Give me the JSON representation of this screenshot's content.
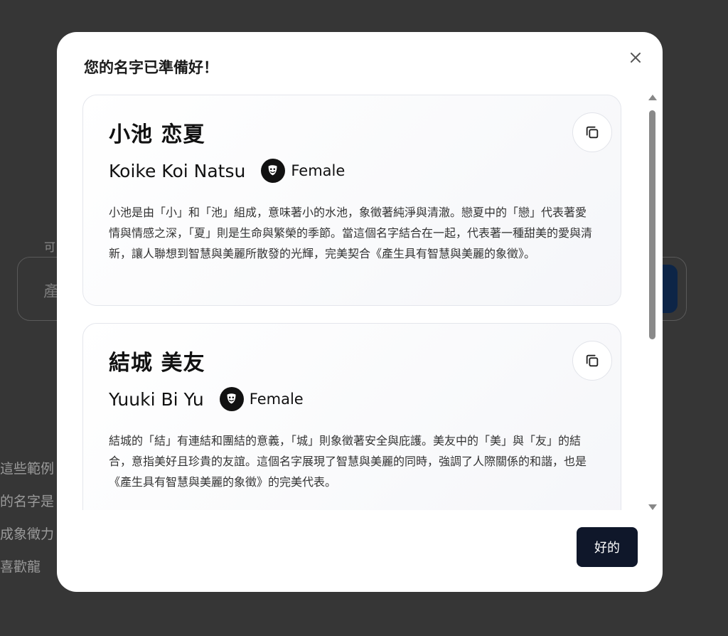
{
  "background": {
    "field_label": "可",
    "input_value": "產",
    "text_lines": [
      "這些範例",
      "的名字是",
      "成象徵力",
      "喜歡龍"
    ]
  },
  "modal": {
    "title": "您的名字已準備好！",
    "close_icon": "close-icon",
    "ok_label": "好的",
    "names": [
      {
        "japanese": "小池 恋夏",
        "romaji": "Koike Koi Natsu",
        "gender": "Female",
        "gender_icon": "theater-mask-icon",
        "description": "小池是由「小」和「池」組成，意味著小的水池，象徵著純淨與清澈。戀夏中的「戀」代表著愛情與情感之深，「夏」則是生命與繁榮的季節。當這個名字結合在一起，代表著一種甜美的愛與清新，讓人聯想到智慧與美麗所散發的光輝，完美契合《產生具有智慧與美麗的象徵》。"
      },
      {
        "japanese": "結城 美友",
        "romaji": "Yuuki Bi Yu",
        "gender": "Female",
        "gender_icon": "theater-mask-icon",
        "description": "結城的「結」有連結和團結的意義，「城」則象徵著安全與庇護。美友中的「美」與「友」的結合，意指美好且珍貴的友誼。這個名字展現了智慧與美麗的同時，強調了人際關係的和諧，也是《產生具有智慧與美麗的象徵》的完美代表。"
      }
    ]
  },
  "colors": {
    "overlay": "#363636",
    "modal_bg": "#ffffff",
    "primary_button": "#0f172a"
  }
}
